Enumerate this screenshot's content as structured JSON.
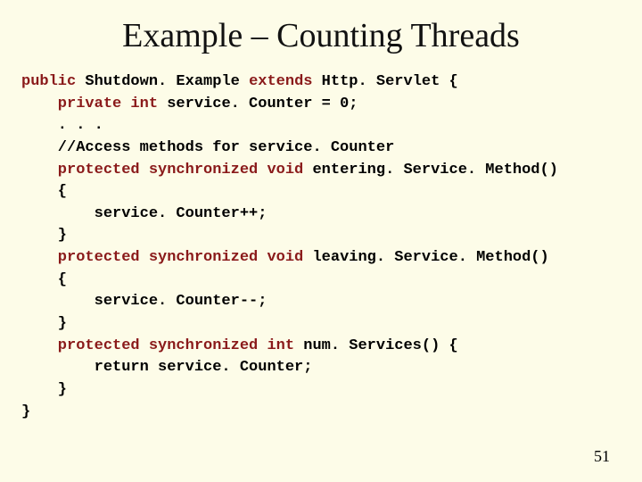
{
  "title": "Example – Counting Threads",
  "code": {
    "l1a": "public",
    "l1b": " Shutdown. Example ",
    "l1c": "extends",
    "l1d": " Http. Servlet {",
    "l2a": "    private int",
    "l2b": " service. Counter = 0;",
    "l3": "    . . .",
    "l4": "    //Access methods for service. Counter",
    "l5a": "    protected synchronized void",
    "l5b": " entering. Service. Method()",
    "l6": "    {",
    "l7": "        service. Counter++;",
    "l8": "    }",
    "l9a": "    protected synchronized void",
    "l9b": " leaving. Service. Method()",
    "l10": "    {",
    "l11": "        service. Counter--;",
    "l12": "    }",
    "l13a": "    protected synchronized int",
    "l13b": " num. Services() {",
    "l14": "        return service. Counter;",
    "l15": "    }",
    "l16": "}"
  },
  "pageNumber": "51"
}
